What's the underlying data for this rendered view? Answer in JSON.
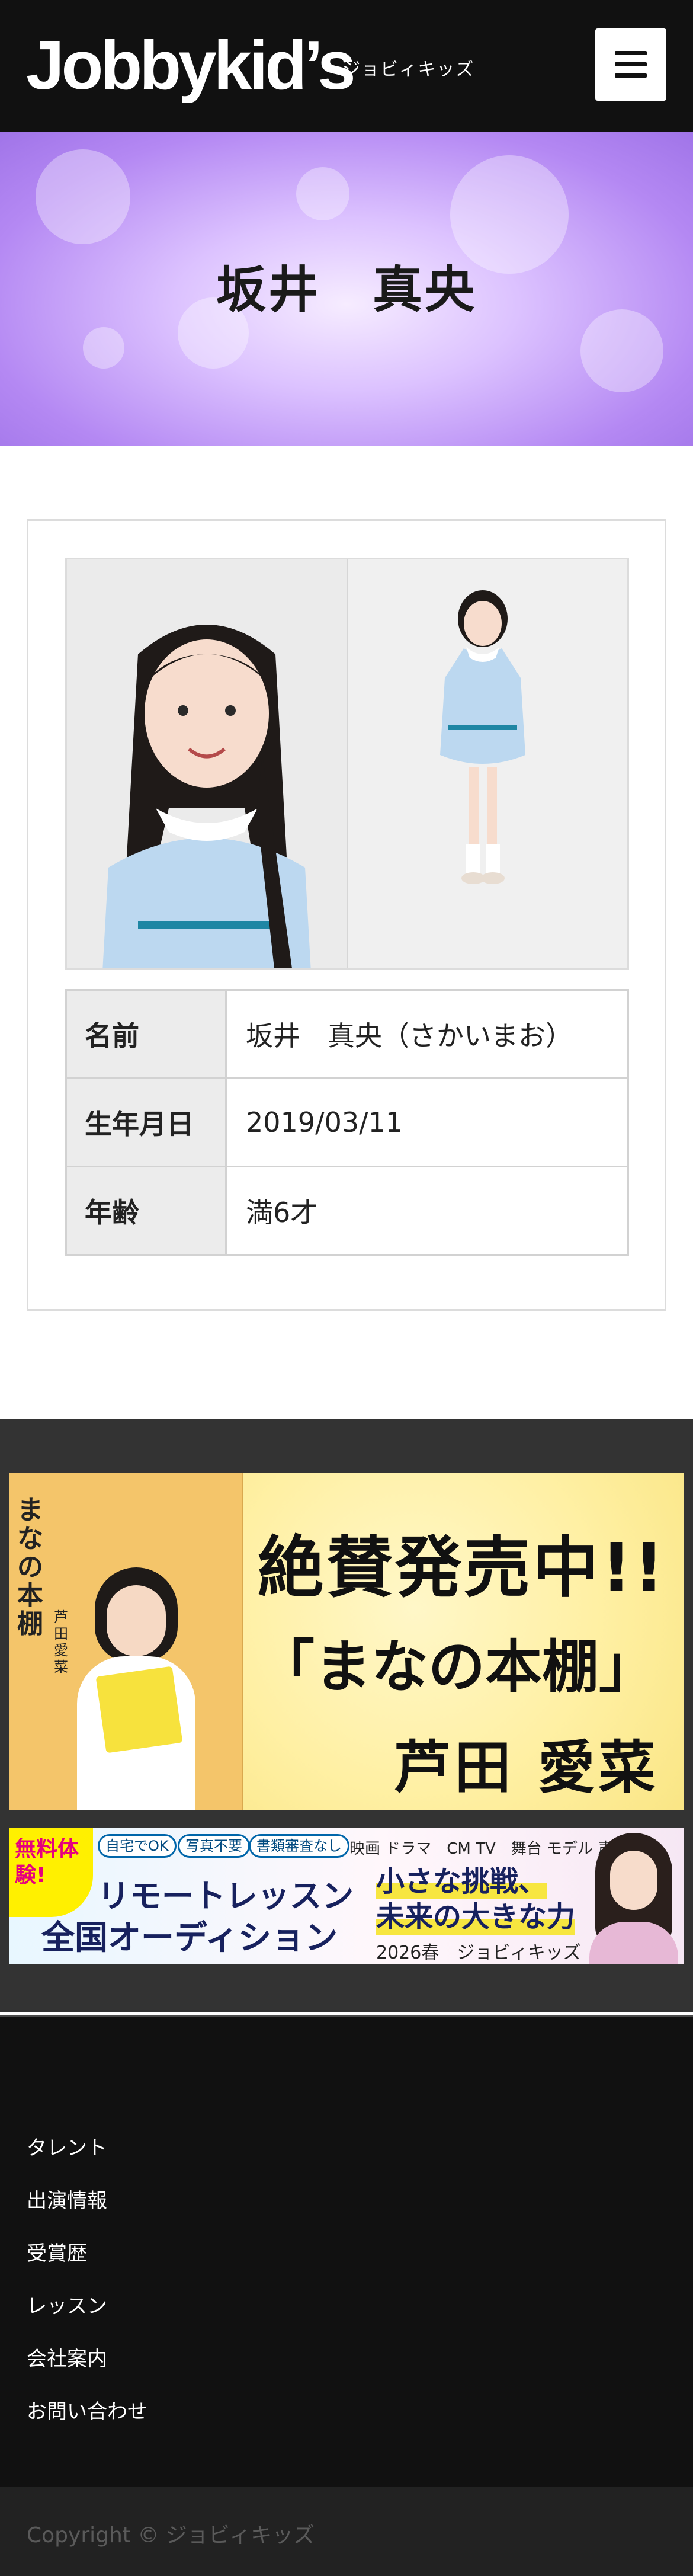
{
  "header": {
    "logo_text": "Jobbykid’s",
    "logo_sub": "ジョビィキッズ",
    "menu_icon": "hamburger-menu-icon"
  },
  "hero": {
    "title": "坂井　真央"
  },
  "profile": {
    "photos": [
      "headshot-photo",
      "full-body-photo"
    ],
    "rows": [
      {
        "label": "名前",
        "value": "坂井　真央（さかいまお）"
      },
      {
        "label": "生年月日",
        "value": "2019/03/11"
      },
      {
        "label": "年齢",
        "value": "満6才"
      }
    ]
  },
  "banners": {
    "book": {
      "cover_title": "まなの本棚",
      "cover_author": "芦田愛菜",
      "headline": "絶賛発売中!!",
      "book_name": "「まなの本棚」",
      "author": "芦田 愛菜"
    },
    "audition": {
      "free": "無料体験!",
      "tags": [
        "自宅でOK",
        "写真不要",
        "書類審査なし"
      ],
      "categories": "映画 ドラマ　CM TV　舞台 モデル 声優",
      "remote": "リモートレッスン",
      "audition": "全国オーディション",
      "tagline_1": "小さな挑戦、",
      "tagline_2": "未来の大きな力",
      "season": "2026春　ジョビィキッズ"
    }
  },
  "footer": {
    "nav": [
      "タレント",
      "出演情報",
      "受賞歴",
      "レッスン",
      "会社案内",
      "お問い合わせ"
    ],
    "copyright": "Copyright © ジョビィキッズ"
  },
  "colors": {
    "header_bg": "#111111",
    "hero_purple": "#b488f3",
    "table_header_bg": "#ececec",
    "footer_bg": "#111111"
  }
}
